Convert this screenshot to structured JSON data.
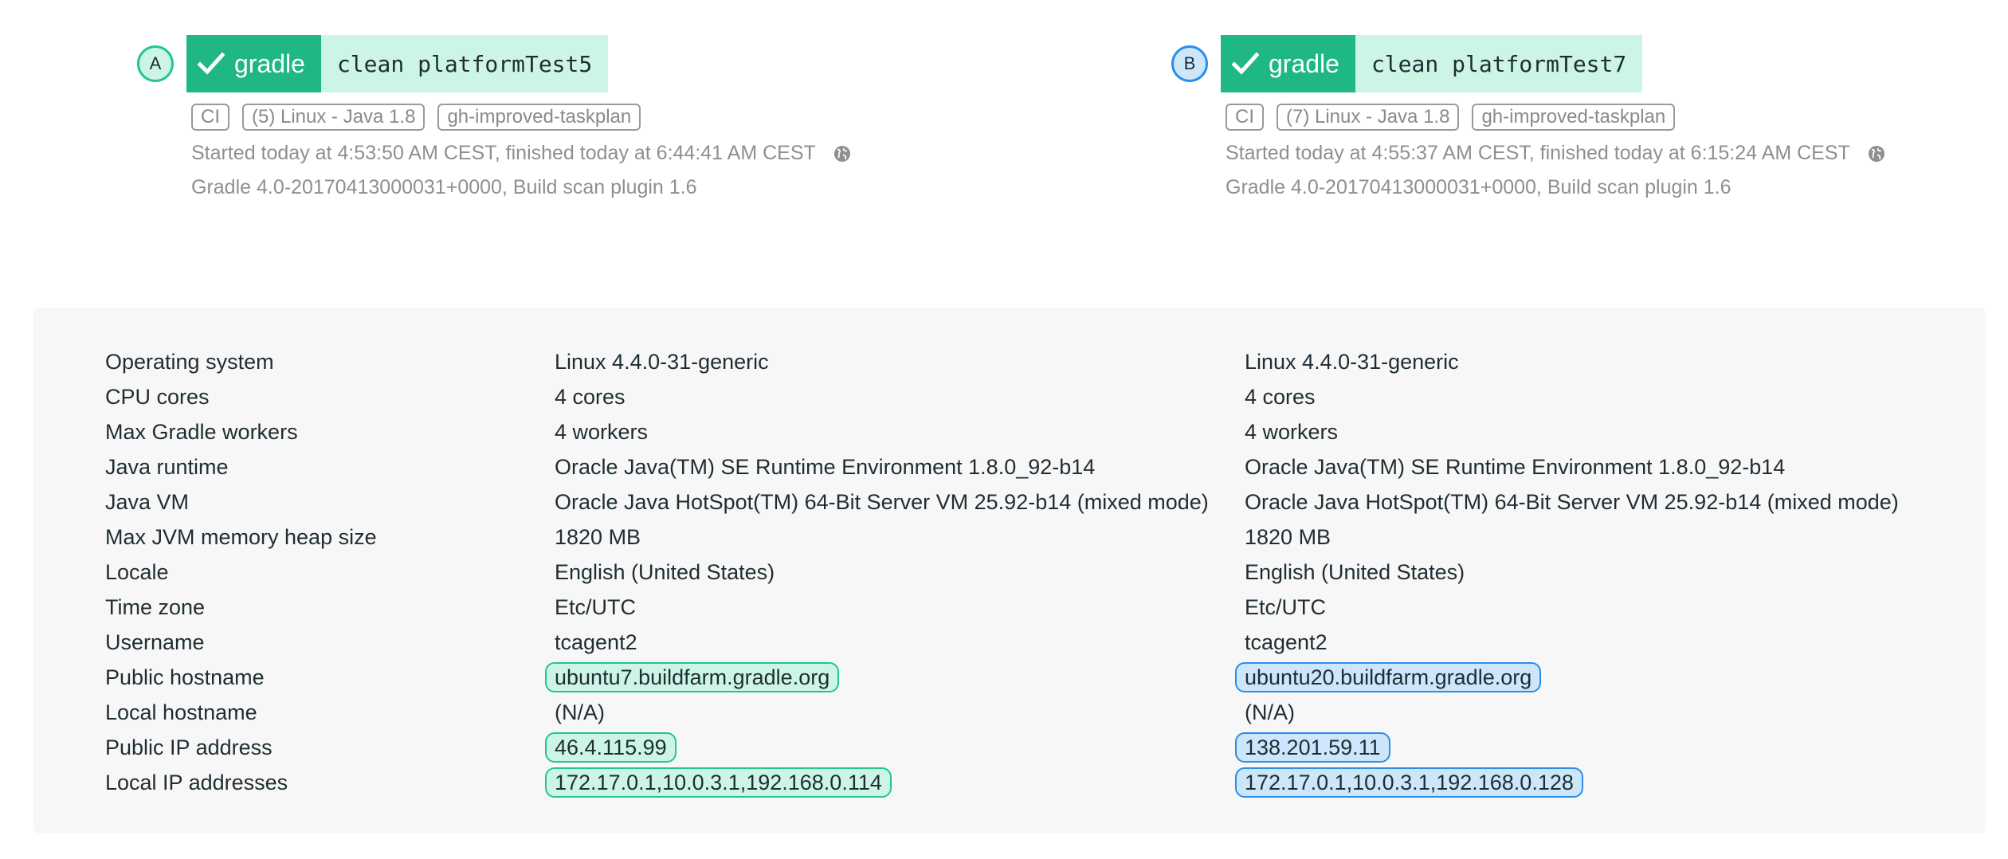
{
  "build_a": {
    "marker": "A",
    "badge": "gradle",
    "task": "clean platformTest5",
    "tags": [
      "CI",
      "(5) Linux - Java 1.8",
      "gh-improved-taskplan"
    ],
    "timing": "Started today at 4:53:50 AM CEST, finished today at 6:44:41 AM CEST",
    "versions": "Gradle 4.0-20170413000031+0000,  Build scan plugin 1.6"
  },
  "build_b": {
    "marker": "B",
    "badge": "gradle",
    "task": "clean platformTest7",
    "tags": [
      "CI",
      "(7) Linux - Java 1.8",
      "gh-improved-taskplan"
    ],
    "timing": "Started today at 4:55:37 AM CEST, finished today at 6:15:24 AM CEST",
    "versions": "Gradle 4.0-20170413000031+0000,  Build scan plugin 1.6"
  },
  "colors": {
    "accent_a": "#22c78b",
    "accent_a_bg": "#cdf5e6",
    "accent_b": "#2b8ee8",
    "accent_b_bg": "#cde6fb",
    "gradle_green": "#1fb885"
  },
  "comparison": [
    {
      "label": "Operating system",
      "a": "Linux 4.4.0-31-generic",
      "b": "Linux 4.4.0-31-generic",
      "differs": false
    },
    {
      "label": "CPU cores",
      "a": "4 cores",
      "b": "4 cores",
      "differs": false
    },
    {
      "label": "Max Gradle workers",
      "a": "4 workers",
      "b": "4 workers",
      "differs": false
    },
    {
      "label": "Java runtime",
      "a": "Oracle Java(TM) SE Runtime Environment 1.8.0_92-b14",
      "b": "Oracle Java(TM) SE Runtime Environment 1.8.0_92-b14",
      "differs": false
    },
    {
      "label": "Java VM",
      "a": "Oracle Java HotSpot(TM) 64-Bit Server VM 25.92-b14 (mixed mode)",
      "b": "Oracle Java HotSpot(TM) 64-Bit Server VM 25.92-b14 (mixed mode)",
      "differs": false
    },
    {
      "label": "Max JVM memory heap size",
      "a": "1820 MB",
      "b": "1820 MB",
      "differs": false
    },
    {
      "label": "Locale",
      "a": "English (United States)",
      "b": "English (United States)",
      "differs": false
    },
    {
      "label": "Time zone",
      "a": "Etc/UTC",
      "b": "Etc/UTC",
      "differs": false
    },
    {
      "label": "Username",
      "a": "tcagent2",
      "b": "tcagent2",
      "differs": false
    },
    {
      "label": "Public hostname",
      "a": "ubuntu7.buildfarm.gradle.org",
      "b": "ubuntu20.buildfarm.gradle.org",
      "differs": true
    },
    {
      "label": "Local hostname",
      "a": "(N/A)",
      "b": "(N/A)",
      "differs": false
    },
    {
      "label": "Public IP address",
      "a": "46.4.115.99",
      "b": "138.201.59.11",
      "differs": true
    },
    {
      "label": "Local IP addresses",
      "a": "172.17.0.1,10.0.3.1,192.168.0.114",
      "b": "172.17.0.1,10.0.3.1,192.168.0.128",
      "differs": true
    }
  ]
}
